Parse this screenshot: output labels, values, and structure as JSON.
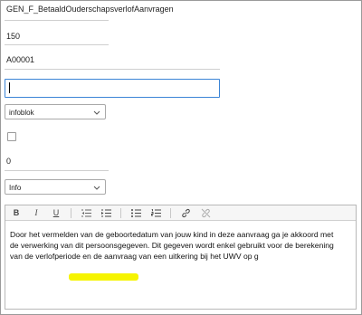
{
  "fields": {
    "name": "GEN_F_BetaaldOuderschapsverlofAanvragen",
    "number": "150",
    "code": "A00001",
    "select1": "infoblok",
    "counter": "0",
    "select2": "Info"
  },
  "toolbar": {
    "bold": "B",
    "italic": "I",
    "underline": "U"
  },
  "editor": {
    "text": "Door het vermelden van de geboortedatum van jouw kind in deze aanvraag ga je akkoord met de verwerking van dit persoonsgegeven. Dit gegeven wordt enkel gebruikt voor de berekening van de verlofperiode en de aanvraag van een uitkering bij het UWV op g"
  },
  "colors": {
    "focus_border": "#3b84d6",
    "highlight": "#f6f400"
  }
}
